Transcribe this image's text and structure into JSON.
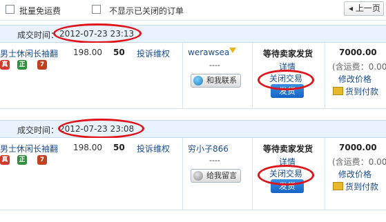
{
  "toolbar": {
    "batch_free_shipping": "批量免运费",
    "hide_closed_label": "不显示已关闭的订单",
    "prev_page": "上一页"
  },
  "orders": [
    {
      "time_label": "成交时间：",
      "time": "2012-07-23 23:13",
      "title": "男士休闲长袖翻",
      "badges": [
        "真",
        "正",
        "7"
      ],
      "price": "198.00",
      "quantity": "50",
      "complaint": "投诉维权",
      "buyer": "werawsea",
      "buyer_dash": "----",
      "contact": "和我联系",
      "status": "等待卖家发货",
      "detail": "详情",
      "close": "关闭交易",
      "ship": "发货",
      "total": "7000.00",
      "shipping_note": "(含运费：0.00)",
      "modify_price": "修改价格",
      "cod": "货到付款"
    },
    {
      "time_label": "成交时间：",
      "time": "2012-07-23 23:08",
      "title": "男士休闲长袖翻",
      "badges": [
        "真",
        "正",
        "7"
      ],
      "price": "198.00",
      "quantity": "50",
      "complaint": "投诉维权",
      "buyer": "穷小子866",
      "buyer_dash": "----",
      "contact": "给我留言",
      "status": "等待卖家发货",
      "detail": "详情",
      "close": "关闭交易",
      "ship": "发货",
      "total": "7000.00",
      "shipping_note": "(含运费：0.00)",
      "modify_price": "修改价格",
      "cod": "货到付款"
    }
  ],
  "colors": {
    "header_bg": "#e8f2fd",
    "link": "#1a4d8f",
    "annotation_red": "#e0131a",
    "ship_button": "#1464c5"
  }
}
